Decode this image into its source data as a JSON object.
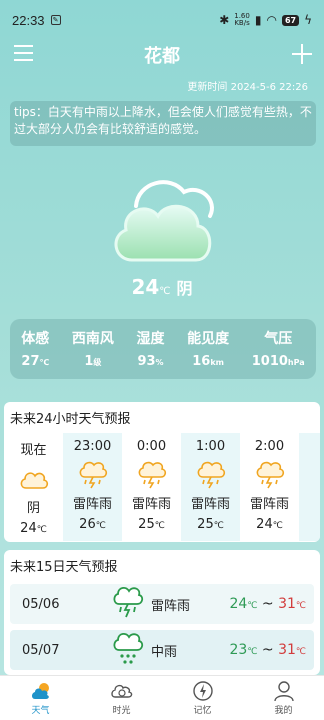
{
  "status_bar": {
    "time": "22:33",
    "net_speed_value": "1.60",
    "net_speed_unit": "KB/s",
    "battery": "67"
  },
  "header": {
    "city": "花都"
  },
  "update_time": "更新时间 2024-5-6 22:26",
  "tips": "tips：白天有中雨以上降水，但会使人们感觉有些热，不过大部分人仍会有比较舒适的感觉。",
  "current": {
    "temp": "24",
    "unit": "℃",
    "condition": "阴",
    "icon": "cloud-icon"
  },
  "metrics": [
    {
      "label": "体感",
      "value": "27",
      "unit": "℃"
    },
    {
      "label": "西南风",
      "value": "1",
      "unit": "级"
    },
    {
      "label": "湿度",
      "value": "93",
      "unit": "%"
    },
    {
      "label": "能见度",
      "value": "16",
      "unit": "km"
    },
    {
      "label": "气压",
      "value": "1010",
      "unit": "hPa"
    }
  ],
  "hourly": {
    "title": "未来24小时天气预报",
    "items": [
      {
        "time": "现在",
        "condition": "阴",
        "temp": "24",
        "unit": "℃",
        "icon": "cloud-icon"
      },
      {
        "time": "23:00",
        "condition": "雷阵雨",
        "temp": "26",
        "unit": "℃",
        "icon": "thunder-rain-icon"
      },
      {
        "time": "0:00",
        "condition": "雷阵雨",
        "temp": "25",
        "unit": "℃",
        "icon": "thunder-rain-icon"
      },
      {
        "time": "1:00",
        "condition": "雷阵雨",
        "temp": "25",
        "unit": "℃",
        "icon": "thunder-rain-icon"
      },
      {
        "time": "2:00",
        "condition": "雷阵雨",
        "temp": "24",
        "unit": "℃",
        "icon": "thunder-rain-icon"
      }
    ]
  },
  "daily": {
    "title": "未来15日天气预报",
    "items": [
      {
        "date": "05/06",
        "condition": "雷阵雨",
        "low": "24",
        "high": "31",
        "unit": "℃",
        "sep": "~",
        "icon": "thunder-rain-icon"
      },
      {
        "date": "05/07",
        "condition": "中雨",
        "low": "23",
        "high": "31",
        "unit": "℃",
        "sep": "~",
        "icon": "rain-icon"
      }
    ]
  },
  "nav": [
    {
      "label": "天气",
      "icon": "weather-icon",
      "active": true
    },
    {
      "label": "时光",
      "icon": "time-icon",
      "active": false
    },
    {
      "label": "记忆",
      "icon": "memory-icon",
      "active": false
    },
    {
      "label": "我的",
      "icon": "profile-icon",
      "active": false
    }
  ],
  "colors": {
    "accent": "#1f93c9",
    "temp_low": "#2e9a55",
    "temp_high": "#d23c3c",
    "background": "#a4ded8"
  }
}
